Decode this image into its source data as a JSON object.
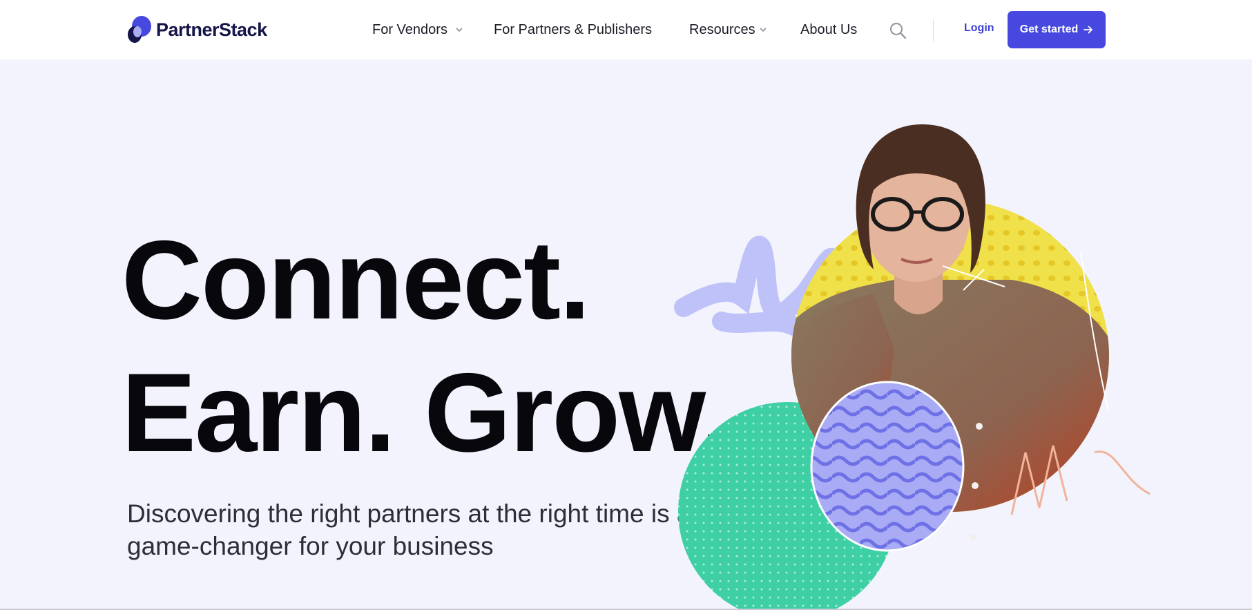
{
  "brand": {
    "name": "PartnerStack",
    "primary_color": "#4648e0",
    "logo_color": "#15154a"
  },
  "nav": {
    "items": [
      {
        "label": "For Vendors",
        "has_dropdown": true
      },
      {
        "label": "For Partners & Publishers",
        "has_dropdown": false
      },
      {
        "label": "Resources",
        "has_dropdown": true
      },
      {
        "label": "About Us",
        "has_dropdown": false
      }
    ],
    "search_icon": "search-icon",
    "login_label": "Login",
    "cta_label": "Get started",
    "cta_icon": "arrow-right-icon"
  },
  "hero": {
    "headline_line1": "Connect.",
    "headline_line2": "Earn. Grow.",
    "subheadline": "Discovering the right partners at the right time is a game-changer for your business",
    "background_color": "#f2f3fd",
    "illustration_colors": {
      "yellow_circle": "#f0e04a",
      "teal_circle": "#3ecfa5",
      "wave_circle": "#a9abf5",
      "scribble": "#b5b8f7"
    }
  }
}
